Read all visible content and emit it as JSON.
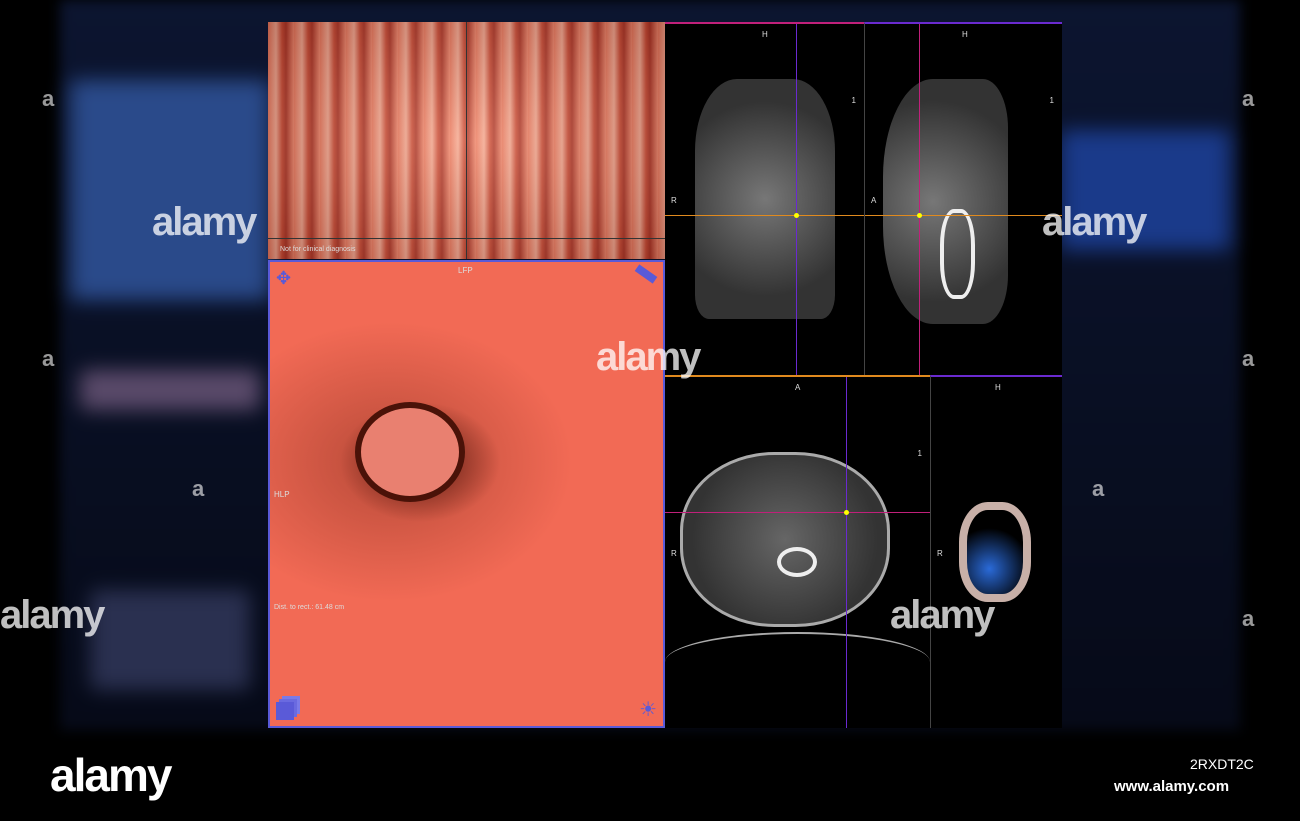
{
  "viewers": {
    "unfolded": {
      "disclaimer": "Not for clinical diagnosis"
    },
    "endoluminal": {
      "top_label": "LFP",
      "left_label": "HLP",
      "distance": "Dist. to rect.: 61.48 cm"
    },
    "coronal": {
      "top_label": "H",
      "left_label": "R",
      "index": "1"
    },
    "sagittal": {
      "top_label": "H",
      "left_label": "A",
      "index": "1"
    },
    "axial": {
      "top_label": "A",
      "left_label": "R",
      "index": "1"
    },
    "volume": {
      "top_label": "H",
      "left_label": "R"
    }
  },
  "watermark": {
    "brand": "alamy",
    "letter": "a",
    "image_id": "2RXDT2C",
    "url": "www.alamy.com"
  },
  "colors": {
    "tissue": "#f26a55",
    "frame": "#5a5ad8",
    "crosshair_orange": "#e08a1e",
    "crosshair_magenta": "#c0207a",
    "crosshair_purple": "#6a2ad0"
  }
}
